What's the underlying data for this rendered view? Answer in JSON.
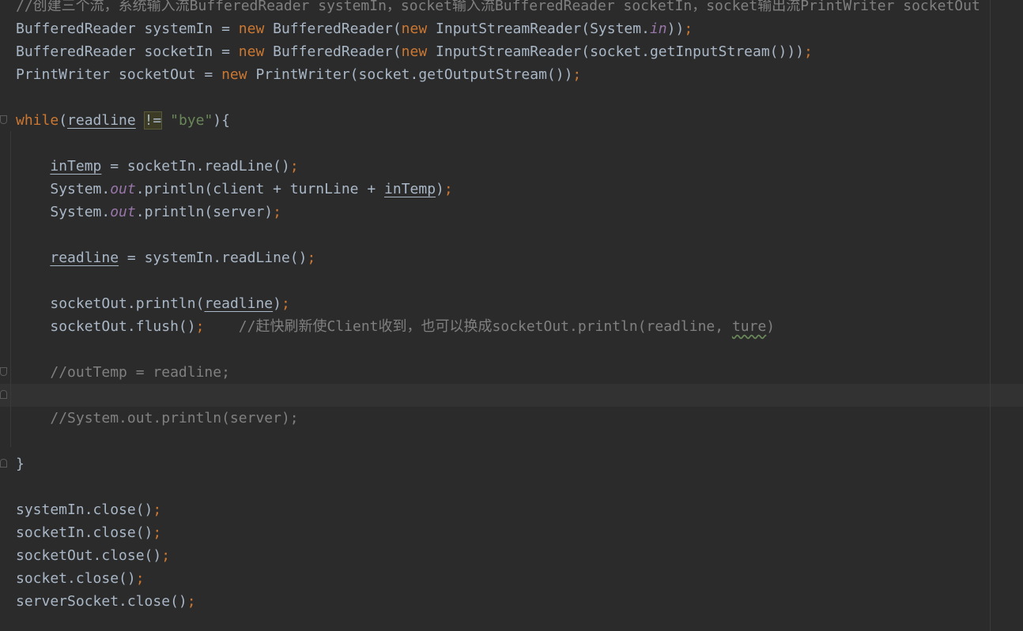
{
  "editor": {
    "lines": {
      "comment_header": "//创建三个流，系统输入流BufferedReader systemIn，socket输入流BufferedReader socketIn，socket输出流PrintWriter socketOut",
      "l2": {
        "a": "BufferedReader systemIn = ",
        "kw1": "new",
        "b": " BufferedReader(",
        "kw2": "new",
        "c": " InputStreamReader(System.",
        "field": "in",
        "d": "))",
        "semi": ";"
      },
      "l3": {
        "a": "BufferedReader socketIn = ",
        "kw1": "new",
        "b": " BufferedReader(",
        "kw2": "new",
        "c": " InputStreamReader(socket.getInputStream()))",
        "semi": ";"
      },
      "l4": {
        "a": "PrintWriter socketOut = ",
        "kw1": "new",
        "b": " PrintWriter(socket.getOutputStream())",
        "semi": ";"
      },
      "l6": {
        "kw": "while",
        "open": "(",
        "var": "readline",
        "sp": " ",
        "op": "!=",
        "sp2": " ",
        "str": "\"bye\"",
        "close": "){"
      },
      "l8": {
        "indent": "    ",
        "var": "inTemp",
        "rest": " = socketIn.readLine()",
        "semi": ";"
      },
      "l9": {
        "indent": "    ",
        "a": "System.",
        "field": "out",
        "b": ".println(client + turnLine + ",
        "var": "inTemp",
        "c": ")",
        "semi": ";"
      },
      "l10": {
        "indent": "    ",
        "a": "System.",
        "field": "out",
        "b": ".println(server)",
        "semi": ";"
      },
      "l12": {
        "indent": "    ",
        "var": "readline",
        "rest": " = systemIn.readLine()",
        "semi": ";"
      },
      "l14": {
        "indent": "    ",
        "a": "socketOut.println(",
        "var": "readline",
        "b": ")",
        "semi": ";"
      },
      "l15": {
        "indent": "    ",
        "a": "socketOut.flush()",
        "semi": ";",
        "gap": "    ",
        "comment_a": "//赶快刷新使Client收到，也可以换成socketOut.println(readline, ",
        "comment_typo": "ture",
        "comment_b": ")"
      },
      "l17": {
        "indent": "    ",
        "comment": "//outTemp = readline;"
      },
      "l19": {
        "indent": "    ",
        "comment": "//System.out.println(server);"
      },
      "l21": {
        "brace": "}"
      },
      "l23": {
        "a": "systemIn.close()",
        "semi": ";"
      },
      "l24": {
        "a": "socketIn.close()",
        "semi": ";"
      },
      "l25": {
        "a": "socketOut.close()",
        "semi": ";"
      },
      "l26": {
        "a": "socket.close()",
        "semi": ";"
      },
      "l27": {
        "a": "serverSocket.close()",
        "semi": ";"
      }
    },
    "colors": {
      "background": "#2b2b2b",
      "default_text": "#a9b7c6",
      "keyword": "#cc7832",
      "string": "#6a8759",
      "comment": "#808080",
      "static_field": "#9876aa",
      "current_line": "#323232"
    }
  }
}
